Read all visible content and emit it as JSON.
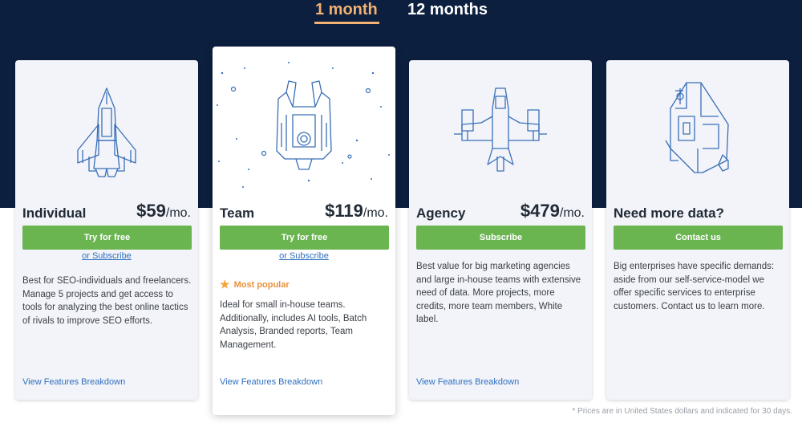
{
  "billing_tabs": {
    "monthly": "1 month",
    "yearly": "12 months"
  },
  "plans": [
    {
      "name": "Individual",
      "price": "$59",
      "unit": "/mo.",
      "cta": "Try for free",
      "secondary": "or Subscribe",
      "description": "Best for SEO-individuals and freelancers. Manage 5 projects and get access to tools for analyzing the best online tactics of rivals to improve SEO efforts.",
      "features_link": "View Features Breakdown",
      "icon": "rocket-ship-icon"
    },
    {
      "name": "Team",
      "price": "$119",
      "unit": "/mo.",
      "cta": "Try for free",
      "secondary": "or Subscribe",
      "badge": "Most popular",
      "description": "Ideal for small in-house teams. Additionally, includes AI tools, Batch Analysis, Branded reports, Team Management.",
      "features_link": "View Features Breakdown",
      "icon": "spaceship-icon"
    },
    {
      "name": "Agency",
      "price": "$479",
      "unit": "/mo.",
      "cta": "Subscribe",
      "description": "Best value for big marketing agencies and large in-house teams with extensive need of data. More projects, more credits, more team members, White label.",
      "features_link": "View Features Breakdown",
      "icon": "starfighter-icon"
    },
    {
      "name": "Need more data?",
      "cta": "Contact us",
      "description": "Big enterprises have specific demands: aside from our self-service-model we offer specific services to enterprise customers. Contact us to learn more.",
      "icon": "mothership-icon"
    }
  ],
  "footnote": "* Prices are in United States dollars and indicated for 30 days.",
  "colors": {
    "hero": "#0c1f3f",
    "accent": "#f3b173",
    "cta": "#6bb551",
    "link": "#2f6fbf",
    "illustration": "#3a6fb8"
  }
}
